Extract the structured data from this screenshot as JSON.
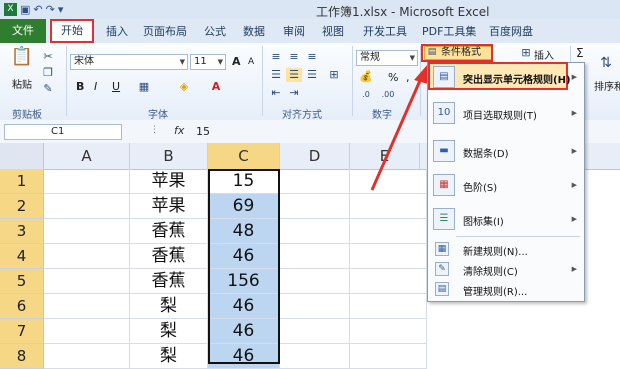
{
  "window": {
    "title": "工作簿1.xlsx - Microsoft Excel"
  },
  "tabs": {
    "file": "文件",
    "home": "开始",
    "insert": "插入",
    "page_layout": "页面布局",
    "formulas": "公式",
    "data": "数据",
    "review": "审阅",
    "view": "视图",
    "developer": "开发工具",
    "pdf": "PDF工具集",
    "baidu": "百度网盘"
  },
  "ribbon": {
    "clipboard": {
      "paste": "粘贴",
      "group": "剪贴板"
    },
    "font": {
      "name": "宋体",
      "size": "11",
      "group": "字体",
      "bold": "B",
      "italic": "I",
      "underline": "U",
      "grow": "A",
      "shrink": "A"
    },
    "alignment": {
      "group": "对齐方式"
    },
    "number": {
      "format": "常规",
      "group": "数字",
      "percent": "%",
      "comma": ",",
      "currency": "⬚"
    },
    "styles": {
      "conditional_format": "条件格式"
    },
    "cells": {
      "insert": "插入"
    },
    "editing": {
      "sum": "Σ",
      "sort": "排序和"
    }
  },
  "formula_bar": {
    "name_box": "C1",
    "fx": "fx",
    "content": "15"
  },
  "columns": [
    "A",
    "B",
    "C",
    "D",
    "E"
  ],
  "rows": [
    {
      "num": "1",
      "b": "苹果",
      "c": "15"
    },
    {
      "num": "2",
      "b": "苹果",
      "c": "69"
    },
    {
      "num": "3",
      "b": "香蕉",
      "c": "48"
    },
    {
      "num": "4",
      "b": "香蕉",
      "c": "46"
    },
    {
      "num": "5",
      "b": "香蕉",
      "c": "156"
    },
    {
      "num": "6",
      "b": "梨",
      "c": "46"
    },
    {
      "num": "7",
      "b": "梨",
      "c": "46"
    },
    {
      "num": "8",
      "b": "梨",
      "c": "46"
    }
  ],
  "menu": {
    "highlight_rules": "突出显示单元格规则(H)",
    "top_bottom": "项目选取规则(T)",
    "data_bars": "数据条(D)",
    "color_scales": "色阶(S)",
    "icon_sets": "图标集(I)",
    "new_rule": "新建规则(N)...",
    "clear_rules": "清除规则(C)",
    "manage_rules": "管理规则(R)..."
  },
  "colors": {
    "accent_red": "#e0312c",
    "file_green": "#2f7d2f",
    "selection_blue": "#bcd6f2"
  }
}
